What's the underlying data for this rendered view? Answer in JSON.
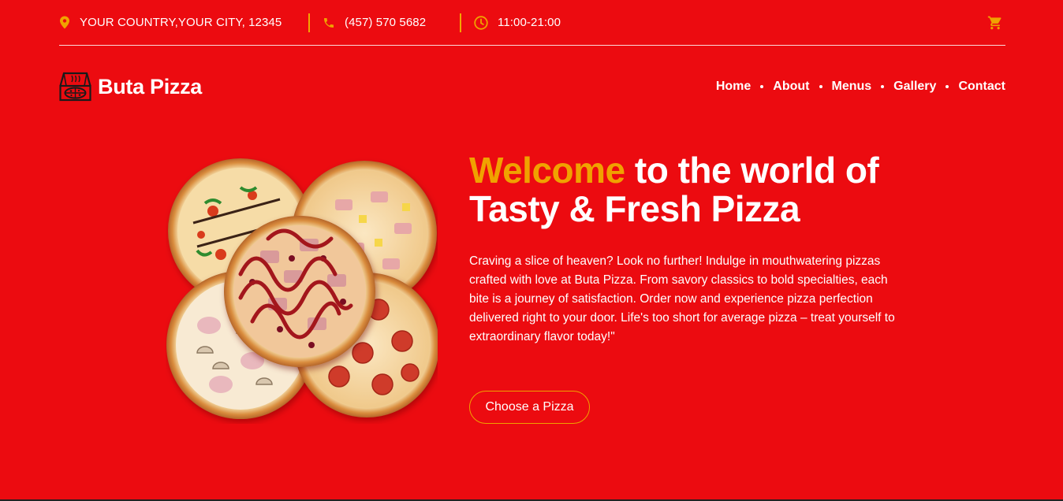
{
  "topbar": {
    "address": "YOUR COUNTRY,YOUR CITY, 12345",
    "phone": "(457) 570 5682",
    "hours": "11:00-21:00",
    "icons": [
      "location-pin-icon",
      "phone-icon",
      "clock-icon",
      "cart-icon"
    ]
  },
  "brand": {
    "name": "Buta Pizza",
    "logo_icon": "pizza-box-icon"
  },
  "nav": {
    "items": [
      "Home",
      "About",
      "Menus",
      "Gallery",
      "Contact"
    ]
  },
  "hero": {
    "title_accent": "Welcome",
    "title_rest": " to the world of Tasty & Fresh Pizza",
    "description": "Craving a slice of heaven? Look no further! Indulge in mouthwatering pizzas crafted with love at Buta Pizza. From savory classics to bold specialties, each bite is a journey of satisfaction. Order now and experience pizza perfection delivered right to your door. Life's too short for average pizza – treat yourself to extraordinary flavor today!\"",
    "cta_label": "Choose a Pizza"
  },
  "colors": {
    "background": "#ec0b10",
    "accent": "#f0a200",
    "text": "#ffffff"
  }
}
